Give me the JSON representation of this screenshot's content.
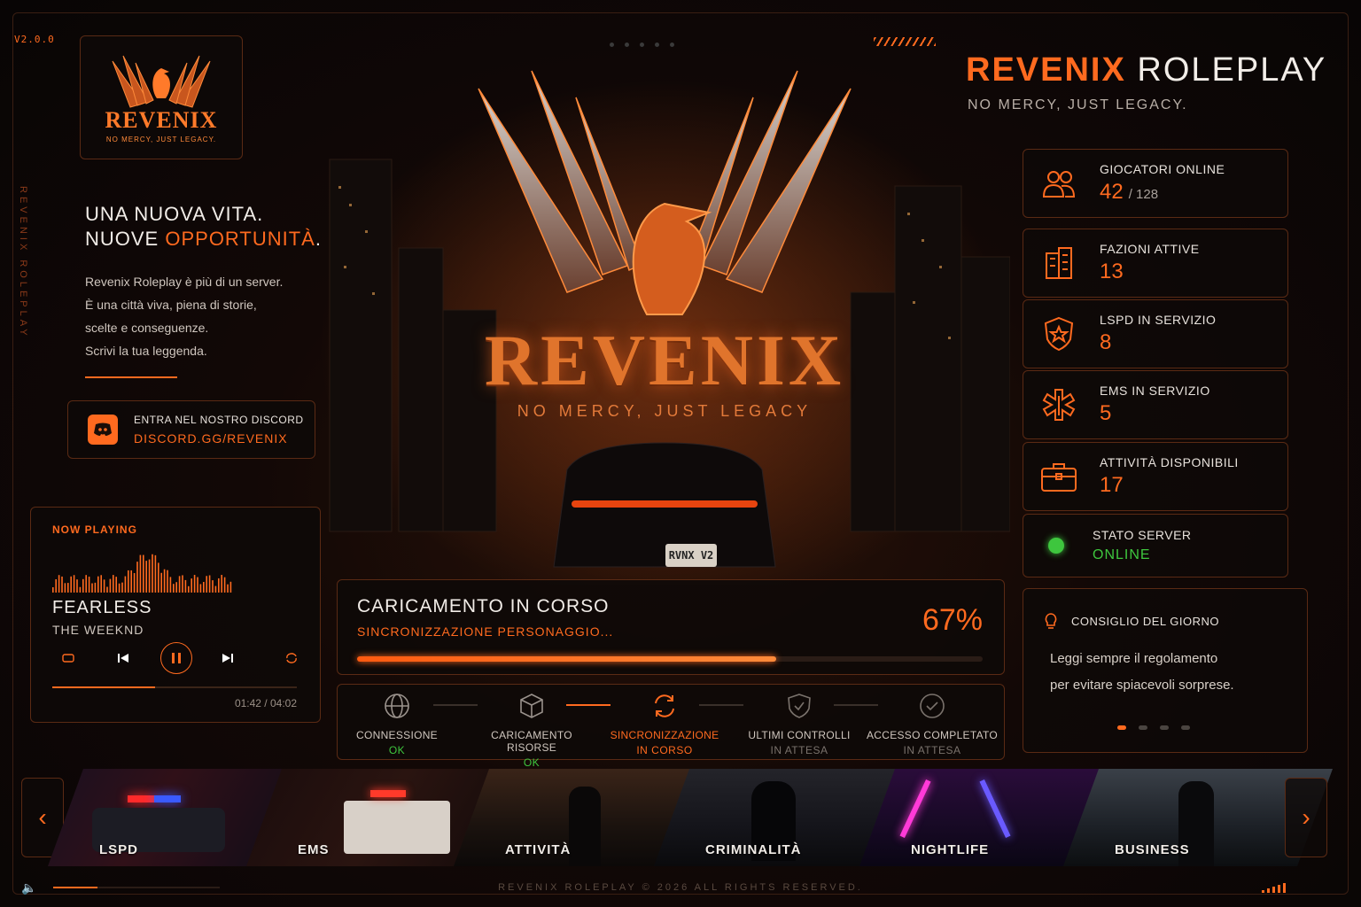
{
  "version": "V2.0.0",
  "side_vertical_text": "REVENIX ROLEPLAY",
  "logo": {
    "name": "REVENIX",
    "tagline": "NO MERCY, JUST LEGACY."
  },
  "headline": {
    "line1": "UNA NUOVA VITA.",
    "line2_prefix": "NUOVE ",
    "line2_accent": "OPPORTUNITÀ",
    "line2_suffix": "."
  },
  "intro": [
    "Revenix Roleplay è più di un server.",
    "È una città viva, piena di storie,",
    "scelte e conseguenze.",
    "Scrivi la tua leggenda."
  ],
  "discord": {
    "label": "ENTRA NEL NOSTRO DISCORD",
    "link": "DISCORD.GG/REVENIX"
  },
  "music": {
    "now_playing": "NOW PLAYING",
    "title": "FEARLESS",
    "artist": "THE WEEKND",
    "time": "01:42 / 04:02",
    "progress": 0.42
  },
  "hero": {
    "name": "REVENIX",
    "tagline": "NO MERCY, JUST LEGACY",
    "plate": "RVNX V2"
  },
  "brand": {
    "accent": "REVENIX",
    "rest": "ROLEPLAY",
    "subtitle": "NO MERCY, JUST LEGACY."
  },
  "stats": [
    {
      "icon": "users-icon",
      "label": "GIOCATORI ONLINE",
      "value": "42",
      "suffix": "/ 128"
    },
    {
      "icon": "building-icon",
      "label": "FAZIONI ATTIVE",
      "value": "13",
      "suffix": ""
    },
    {
      "icon": "police-badge-icon",
      "label": "LSPD IN SERVIZIO",
      "value": "8",
      "suffix": ""
    },
    {
      "icon": "medical-star-icon",
      "label": "EMS IN SERVIZIO",
      "value": "5",
      "suffix": ""
    },
    {
      "icon": "briefcase-icon",
      "label": "ATTIVITÀ DISPONIBILI",
      "value": "17",
      "suffix": ""
    }
  ],
  "server_status": {
    "label": "STATO SERVER",
    "value": "ONLINE"
  },
  "tip": {
    "title": "CONSIGLIO DEL GIORNO",
    "line1": "Leggi sempre il regolamento",
    "line2": "per evitare spiacevoli sorprese."
  },
  "loading": {
    "title": "CARICAMENTO IN CORSO",
    "subtitle": "SINCRONIZZAZIONE PERSONAGGIO...",
    "percent_label": "67%",
    "progress": 0.67
  },
  "steps": [
    {
      "icon": "globe-icon",
      "label": "CONNESSIONE",
      "state": "OK",
      "status": "ok"
    },
    {
      "icon": "cube-icon",
      "label": "CARICAMENTO RISORSE",
      "state": "OK",
      "status": "ok"
    },
    {
      "icon": "sync-icon",
      "label": "SINCRONIZZAZIONE",
      "state": "IN CORSO",
      "status": "active"
    },
    {
      "icon": "shield-check-icon",
      "label": "ULTIMI CONTROLLI",
      "state": "IN ATTESA",
      "status": "pending"
    },
    {
      "icon": "check-circle-icon",
      "label": "ACCESSO COMPLETATO",
      "state": "IN ATTESA",
      "status": "pending"
    }
  ],
  "carousel": [
    "LSPD",
    "EMS",
    "ATTIVITÀ",
    "CRIMINALITÀ",
    "NIGHTLIFE",
    "BUSINESS"
  ],
  "footer": "REVENIX ROLEPLAY © 2026 ALL RIGHTS RESERVED.",
  "colors": {
    "accent": "#ff6a1f",
    "success": "#3ec63e",
    "background": "#0a0707"
  }
}
